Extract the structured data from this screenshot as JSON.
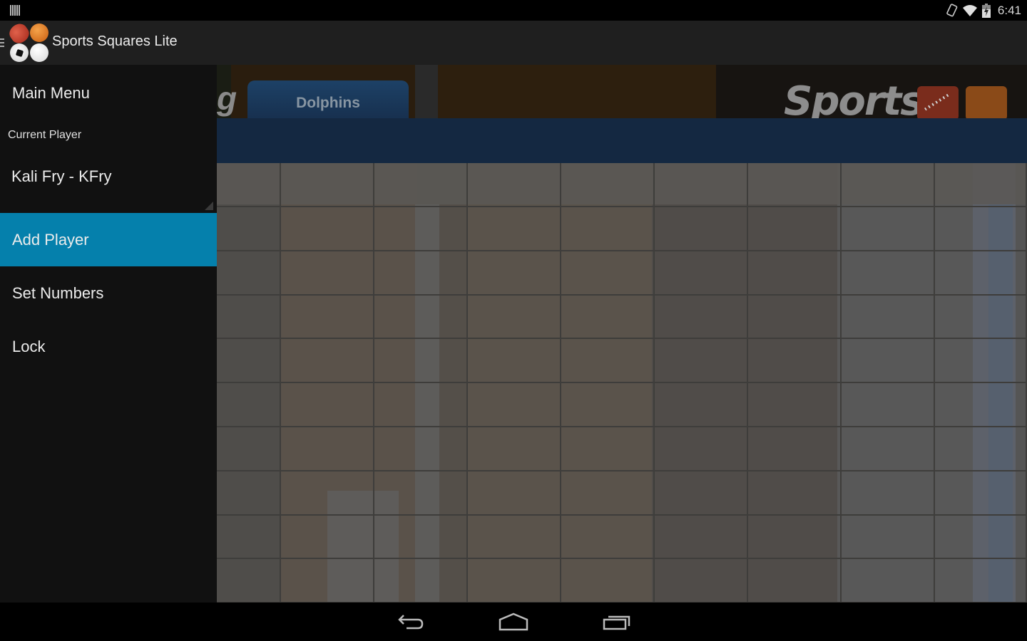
{
  "status_bar": {
    "time": "6:41",
    "icons": [
      "notification-bars-icon",
      "rotation-lock-icon",
      "wifi-icon",
      "battery-charging-icon"
    ]
  },
  "action_bar": {
    "app_title": "Sports Squares Lite",
    "logo_icon": "sports-balls-logo-icon",
    "drawer_indicator_icon": "drawer-indicator-icon"
  },
  "drawer": {
    "title": "Main Menu",
    "current_player_label": "Current Player",
    "current_player_value": "Kali Fry - KFry",
    "items": [
      {
        "label": "Add Player",
        "active": true
      },
      {
        "label": "Set Numbers",
        "active": false
      },
      {
        "label": "Lock",
        "active": false
      }
    ]
  },
  "main": {
    "banner_fragment": "g",
    "banner_logo_text": "Sports",
    "team_tab": "Dolphins",
    "grid": {
      "columns": 9,
      "rows": 10
    }
  },
  "nav_bar": {
    "back": "back-icon",
    "home": "home-icon",
    "recents": "recents-icon"
  },
  "colors": {
    "drawer_active": "#0580ac",
    "drawer_bg": "#111111",
    "action_bar_bg": "#1f1f1f",
    "header_blue": "#142841",
    "tab_blue": "#1d4166"
  }
}
